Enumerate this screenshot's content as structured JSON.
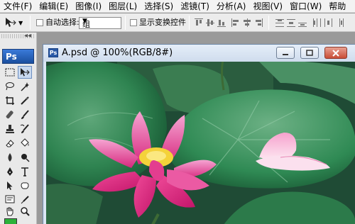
{
  "menu": {
    "items": [
      "文件(F)",
      "编辑(E)",
      "图像(I)",
      "图层(L)",
      "选择(S)",
      "滤镜(T)",
      "分析(A)",
      "视图(V)",
      "窗口(W)",
      "帮助"
    ]
  },
  "options": {
    "auto_select_label": "自动选择:",
    "auto_select_value": "组",
    "show_transform_label": "显示变换控件"
  },
  "toolbox": {
    "logo": "Ps",
    "tools": [
      "rectangular-marquee",
      "move",
      "lasso",
      "magic-wand",
      "crop",
      "slice",
      "healing-brush",
      "brush",
      "clone-stamp",
      "history-brush",
      "eraser",
      "paint-bucket",
      "blur",
      "dodge",
      "pen",
      "type",
      "path-selection",
      "rectangle-shape",
      "notes",
      "eyedropper",
      "hand",
      "zoom"
    ],
    "collapse_label": "◂◂",
    "foreground_color": "#2cb23a"
  },
  "document": {
    "title": "A.psd @ 100%(RGB/8#)",
    "icon_label": "Ps"
  },
  "colors": {
    "menubar_bg": "#f3f3f3",
    "workspace_bg": "#9a9a9a",
    "close_button": "#c94d36"
  }
}
